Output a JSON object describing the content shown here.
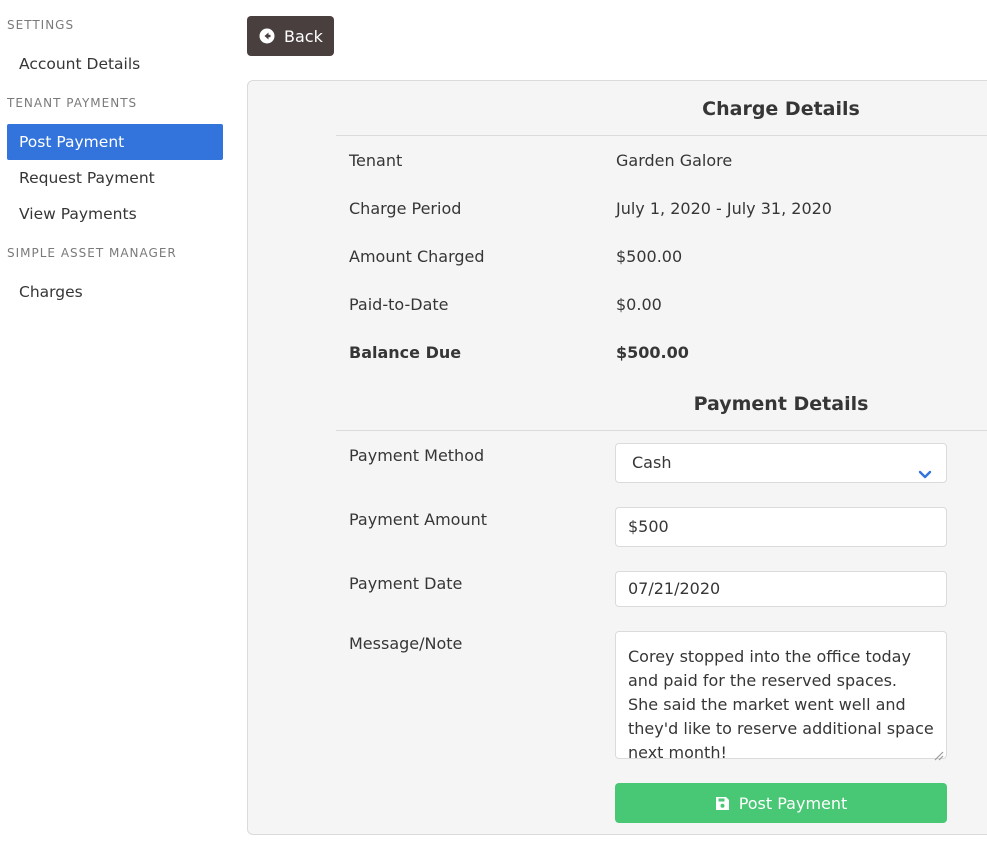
{
  "sidebar": {
    "sections": [
      {
        "label": "SETTINGS",
        "items": [
          {
            "label": "Account Details"
          }
        ]
      },
      {
        "label": "TENANT PAYMENTS",
        "items": [
          {
            "label": "Post Payment",
            "active": true
          },
          {
            "label": "Request Payment"
          },
          {
            "label": "View Payments"
          }
        ]
      },
      {
        "label": "SIMPLE ASSET MANAGER",
        "items": [
          {
            "label": "Charges"
          }
        ]
      }
    ]
  },
  "back_button": {
    "label": "Back",
    "icon": "arrow-circle-left-icon"
  },
  "charge_details": {
    "title": "Charge Details",
    "rows": [
      {
        "label": "Tenant",
        "value": "Garden Galore"
      },
      {
        "label": "Charge Period",
        "value": "July 1, 2020 - July 31, 2020"
      },
      {
        "label": "Amount Charged",
        "value": "$500.00"
      },
      {
        "label": "Paid-to-Date",
        "value": "$0.00"
      },
      {
        "label": "Balance Due",
        "value": "$500.00"
      }
    ]
  },
  "payment_details": {
    "title": "Payment Details",
    "method": {
      "label": "Payment Method",
      "value": "Cash"
    },
    "amount": {
      "label": "Payment Amount",
      "value": "$500"
    },
    "date": {
      "label": "Payment Date",
      "value": "07/21/2020"
    },
    "note": {
      "label": "Message/Note",
      "value": "Corey stopped into the office today and paid for the reserved spaces.  She said the market went well and they'd like to reserve additional space next month!"
    },
    "submit_label": "Post Payment",
    "submit_icon": "save-icon"
  },
  "colors": {
    "accent": "#3273dc",
    "success": "#48c774",
    "back_button": "#4a3f3f"
  }
}
